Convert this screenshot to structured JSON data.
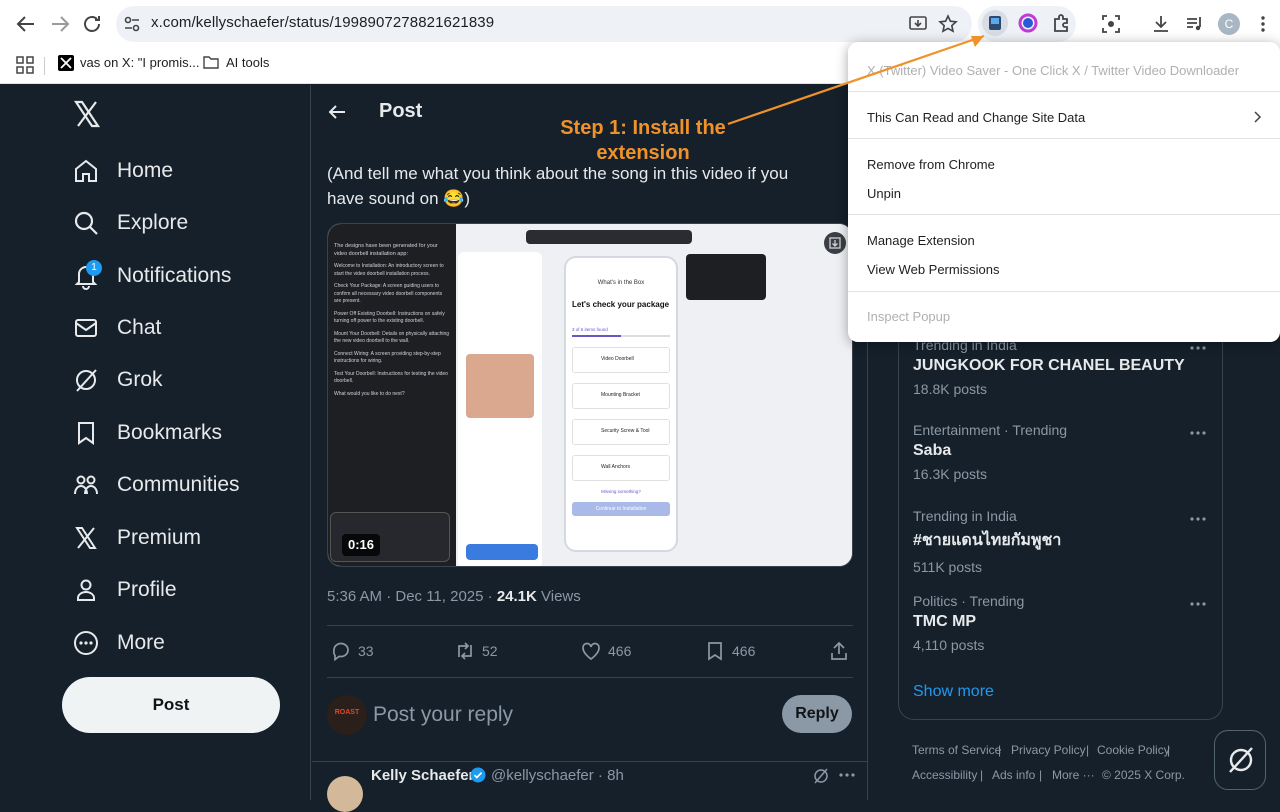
{
  "browser": {
    "url": "x.com/kellyschaefer/status/1998907278821621839",
    "bookmarks": [
      {
        "label": "vas on X: \"I promis..."
      },
      {
        "label": "AI tools"
      }
    ],
    "profile_initial": "C"
  },
  "context_menu": {
    "title": "X (Twitter) Video Saver - One Click X / Twitter Video Downloader",
    "items": [
      {
        "label": "This Can Read and Change Site Data"
      },
      {
        "label": "Remove from Chrome"
      },
      {
        "label": "Unpin"
      },
      {
        "label": "Manage Extension"
      },
      {
        "label": "View Web Permissions"
      },
      {
        "label": "Inspect Popup"
      }
    ]
  },
  "annotation": {
    "text": "Step 1: Install the extension"
  },
  "sidebar": {
    "items": [
      {
        "label": "Home"
      },
      {
        "label": "Explore"
      },
      {
        "label": "Notifications",
        "badge": "1"
      },
      {
        "label": "Chat"
      },
      {
        "label": "Grok"
      },
      {
        "label": "Bookmarks"
      },
      {
        "label": "Communities"
      },
      {
        "label": "Premium"
      },
      {
        "label": "Profile"
      },
      {
        "label": "More"
      }
    ],
    "post_button": "Post"
  },
  "post": {
    "header_title": "Post",
    "text": "(And tell me what you think about the song in this video if you have sound on 😂)",
    "video_time": "0:16",
    "video_lines": [
      "The designs have been generated for your video doorbell installation app:",
      "Welcome to Installation: An introductory screen to start the video doorbell installation process.",
      "Check Your Package: A screen guiding users to confirm all necessary video doorbell components are present.",
      "Power Off Existing Doorbell: Instructions on safely turning off power to the existing doorbell.",
      "Mount Your Doorbell: Details on physically attaching the new video doorbell to the wall.",
      "Connect Wiring: A screen providing step-by-step instructions for wiring.",
      "Test Your Doorbell: Instructions for testing the video doorbell.",
      "What would you like to do next?"
    ],
    "video_phone": {
      "header": "What's in the Box",
      "heading": "Let's check your package",
      "progress": "3 of 6 items found",
      "items": [
        "Video Doorbell",
        "Mounting Bracket",
        "Security Screw & Tool",
        "Wall Anchors"
      ],
      "missing": "Missing something?",
      "cta": "Continue to Installation"
    },
    "time": "5:36 AM · Dec 11, 2025 · ",
    "views_count": "24.1K",
    "views_label": " Views",
    "actions": {
      "replies": "33",
      "reposts": "52",
      "likes": "466",
      "bookmarks": "466"
    },
    "reply_placeholder": "Post your reply",
    "reply_button": "Reply",
    "avatar_text": "ROAST",
    "next_author": "Kelly Schaefer",
    "next_handle": "@kellyschaefer · 8h"
  },
  "trends": [
    {
      "category": "Trending in India",
      "name": "JUNGKOOK FOR CHANEL BEAUTY",
      "count": "18.8K posts"
    },
    {
      "category": "Entertainment · Trending",
      "name": "Saba",
      "count": "16.3K posts"
    },
    {
      "category": "Trending in India",
      "name": "#ชายแดนไทยกัมพูชา",
      "count": "511K posts"
    },
    {
      "category": "Politics · Trending",
      "name": "TMC MP",
      "count": "4,110 posts"
    }
  ],
  "show_more": "Show more",
  "footer": {
    "links": [
      "Terms of Service",
      "Privacy Policy",
      "Cookie Policy",
      "Accessibility",
      "Ads info",
      "More ···",
      "© 2025 X Corp."
    ]
  },
  "colors": {
    "accent": "#1d9bf0",
    "background": "#15202b",
    "annotation": "#f0922a"
  }
}
